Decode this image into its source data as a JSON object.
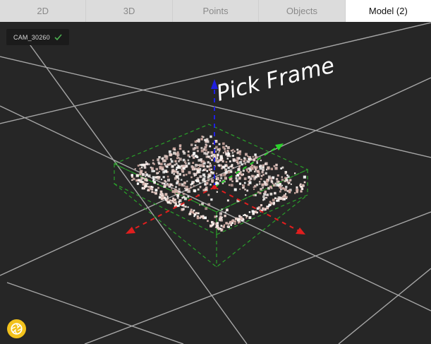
{
  "tabs": [
    {
      "label": "2D",
      "active": false
    },
    {
      "label": "3D",
      "active": false
    },
    {
      "label": "Points",
      "active": false
    },
    {
      "label": "Objects",
      "active": false
    },
    {
      "label": "Model (2)",
      "active": true
    }
  ],
  "camera_badge": {
    "label": "CAM_30260",
    "status_icon": "check-icon"
  },
  "scene": {
    "label": "Pick Frame",
    "bbox_color": "#2aa02a",
    "axis_colors": {
      "x": "#e01e1e",
      "y": "#2bd12b",
      "z": "#2020e0"
    },
    "grid_color": "#bdbdbd"
  },
  "capture_button": {
    "icon": "camera-shutter-icon",
    "color": "#f2c21c"
  }
}
